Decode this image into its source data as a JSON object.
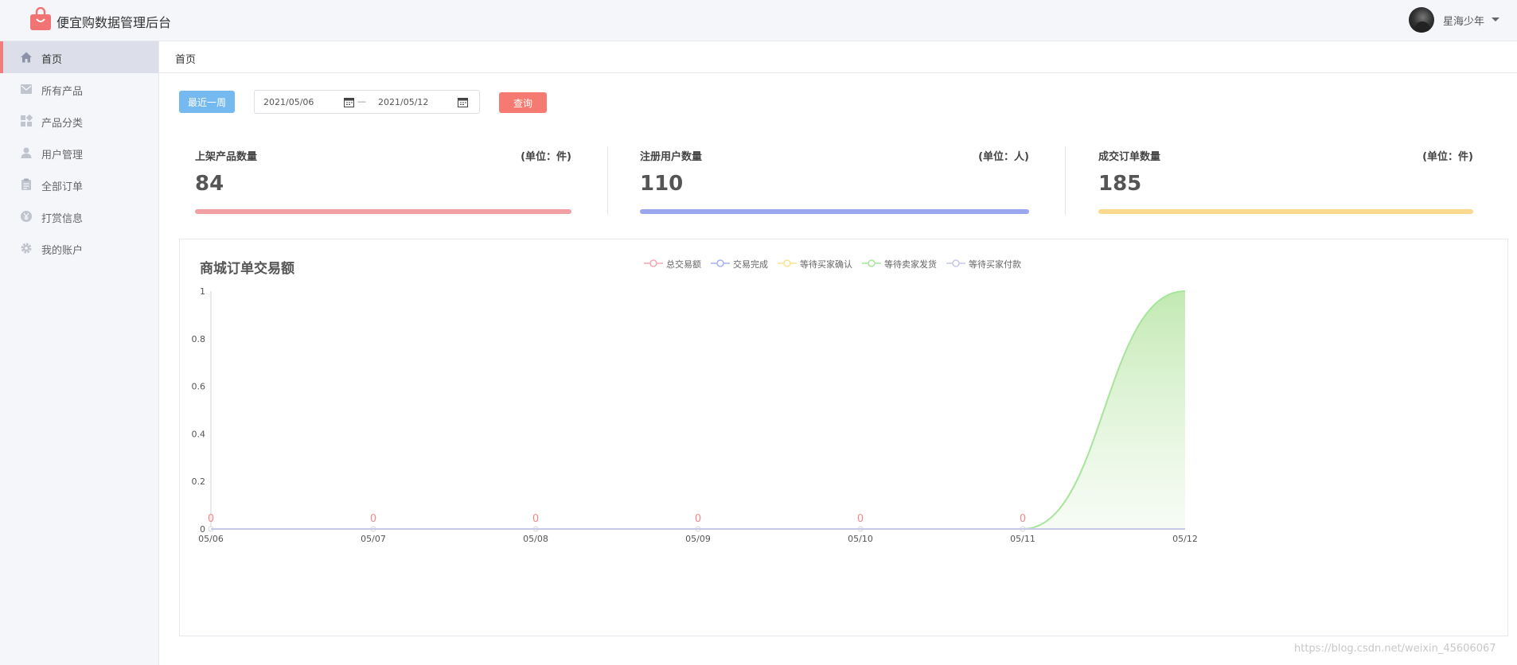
{
  "app": {
    "title": "便宜购数据管理后台",
    "logo_icon": "shopping-bag-icon"
  },
  "user": {
    "name": "星海少年"
  },
  "sidebar": {
    "items": [
      {
        "label": "首页",
        "icon": "home-icon",
        "active": true
      },
      {
        "label": "所有产品",
        "icon": "mail-icon",
        "active": false
      },
      {
        "label": "产品分类",
        "icon": "category-icon",
        "active": false
      },
      {
        "label": "用户管理",
        "icon": "user-icon",
        "active": false
      },
      {
        "label": "全部订单",
        "icon": "clipboard-icon",
        "active": false
      },
      {
        "label": "打赏信息",
        "icon": "yen-coin-icon",
        "active": false
      },
      {
        "label": "我的账户",
        "icon": "gear-icon",
        "active": false
      }
    ]
  },
  "breadcrumb": {
    "current": "首页"
  },
  "filters": {
    "week_button": "最近一周",
    "start_date": "2021/05/06",
    "end_date": "2021/05/12",
    "separator": "—",
    "query_button": "查询"
  },
  "stats": [
    {
      "title": "上架产品数量",
      "unit": "(单位：件)",
      "value": "84",
      "bar_color": "#f2a0a4"
    },
    {
      "title": "注册用户数量",
      "unit": "(单位：人)",
      "value": "110",
      "bar_color": "#9aa6ee"
    },
    {
      "title": "成交订单数量",
      "unit": "(单位：件)",
      "value": "185",
      "bar_color": "#fbd98e"
    }
  ],
  "chart": {
    "title": "商城订单交易额",
    "watermark": "https://blog.csdn.net/weixin_45606067"
  },
  "chart_data": {
    "type": "area",
    "categories": [
      "05/06",
      "05/07",
      "05/08",
      "05/09",
      "05/10",
      "05/11",
      "05/12"
    ],
    "ylim": [
      0,
      1
    ],
    "yticks": [
      "0",
      "0.2",
      "0.4",
      "0.6",
      "0.8",
      "1"
    ],
    "legend_position": "top-center",
    "series": [
      {
        "name": "总交易额",
        "color": "#f3a5b1",
        "values": [
          0,
          0,
          0,
          0,
          0,
          0,
          0
        ],
        "labels": [
          "0",
          "0",
          "0",
          "0",
          "0",
          "0",
          ""
        ]
      },
      {
        "name": "交易完成",
        "color": "#a5b1f0",
        "values": [
          0,
          0,
          0,
          0,
          0,
          0,
          0
        ]
      },
      {
        "name": "等待买家确认",
        "color": "#f8e38e",
        "values": [
          0,
          0,
          0,
          0,
          0,
          0,
          0
        ]
      },
      {
        "name": "等待卖家发货",
        "color": "#a6e59a",
        "values": [
          0,
          0,
          0,
          0,
          0,
          0,
          1
        ]
      },
      {
        "name": "等待买家付款",
        "color": "#c7c9e8",
        "values": [
          0,
          0,
          0,
          0,
          0,
          0,
          0
        ]
      }
    ]
  }
}
